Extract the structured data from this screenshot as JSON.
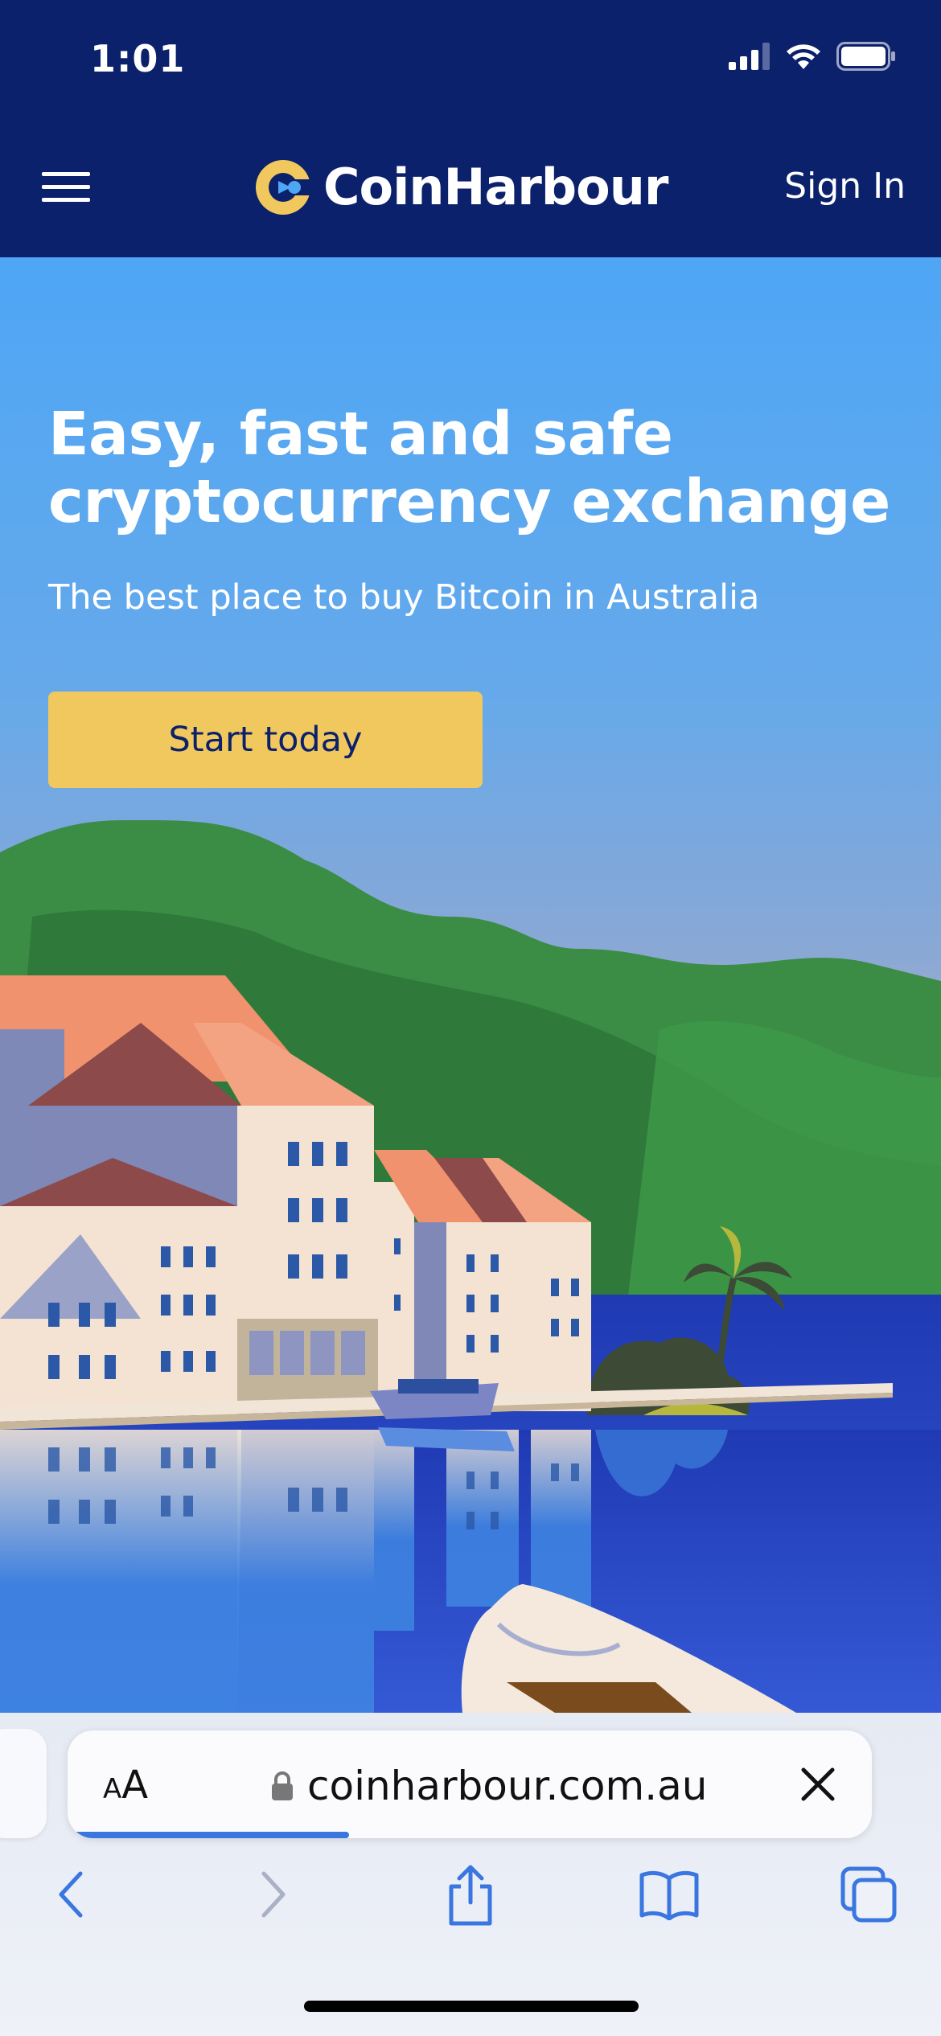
{
  "status_bar": {
    "time": "1:01",
    "icons": [
      "cellular-signal-icon",
      "wifi-icon",
      "battery-icon"
    ]
  },
  "header": {
    "brand": "CoinHarbour",
    "sign_in": "Sign In",
    "icons": [
      "hamburger-menu-icon",
      "coinharbour-logo-icon"
    ],
    "colors": {
      "background": "#0c216b",
      "logo_accent": "#f1c85e",
      "logo_inner": "#4ea6f5"
    }
  },
  "hero": {
    "title": "Easy, fast and safe cryptocurrency exchange",
    "subtitle": "The best place to buy Bitcoin in Australia",
    "cta_label": "Start today",
    "colors": {
      "sky": "#4ea6f5",
      "cta": "#f1c85e",
      "water": "#2a4bd0",
      "hills": "#3a8a45"
    }
  },
  "browser": {
    "text_size_label_small": "A",
    "text_size_label_large": "A",
    "url": "coinharbour.com.au",
    "load_progress": 0.35,
    "icons": [
      "text-size-icon",
      "lock-icon",
      "close-icon",
      "back-icon",
      "forward-icon",
      "share-icon",
      "bookmarks-icon",
      "tabs-icon"
    ]
  }
}
